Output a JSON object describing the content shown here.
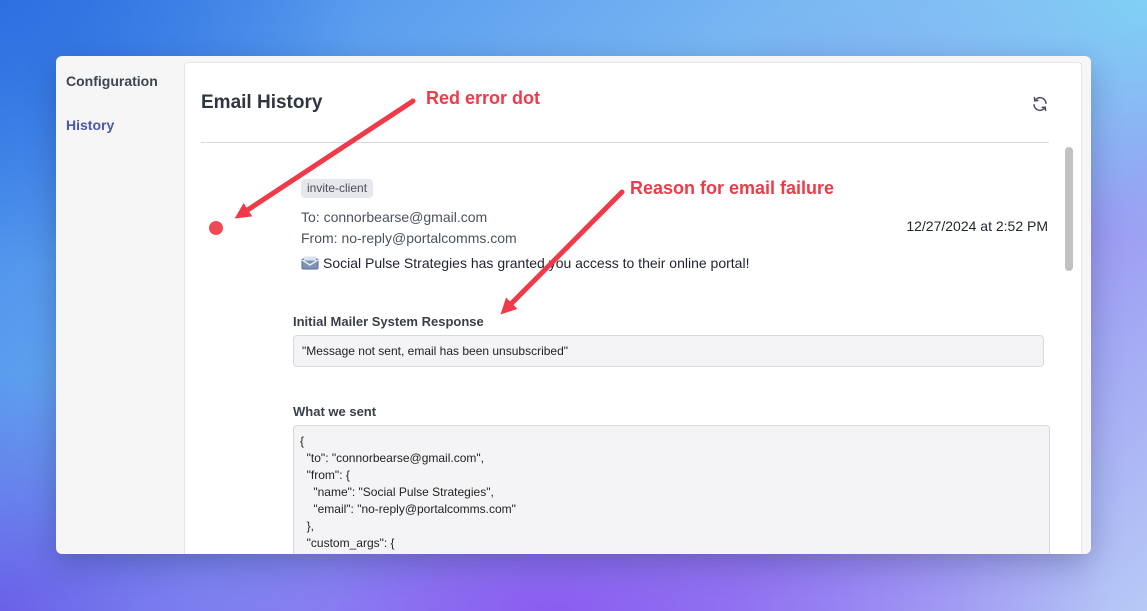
{
  "sidebar": {
    "items": [
      {
        "label": "Configuration",
        "active": false
      },
      {
        "label": "History",
        "active": true
      }
    ]
  },
  "panel": {
    "title": "Email History",
    "refresh_icon": "refresh-icon"
  },
  "email": {
    "template_tag": "invite-client",
    "to": "To: connorbearse@gmail.com",
    "from": "From: no-reply@portalcomms.com",
    "timestamp": "12/27/2024 at 2:52 PM",
    "subject_icon": "envelope-icon",
    "subject": "Social Pulse Strategies has granted you access to their online portal!",
    "status": "error",
    "status_color": "#ee4b54"
  },
  "response_section": {
    "label": "Initial Mailer System Response",
    "value": "\"Message not sent, email has been unsubscribed\""
  },
  "sent_section": {
    "label": "What we sent",
    "payload": "{\n  \"to\": \"connorbearse@gmail.com\",\n  \"from\": {\n    \"name\": \"Social Pulse Strategies\",\n    \"email\": \"no-reply@portalcomms.com\"\n  },\n  \"custom_args\": {\n    \"env\": \"dev\""
  },
  "annotations": {
    "error_dot": "Red error dot",
    "failure_reason": "Reason for email failure",
    "color": "#f03a4a"
  }
}
